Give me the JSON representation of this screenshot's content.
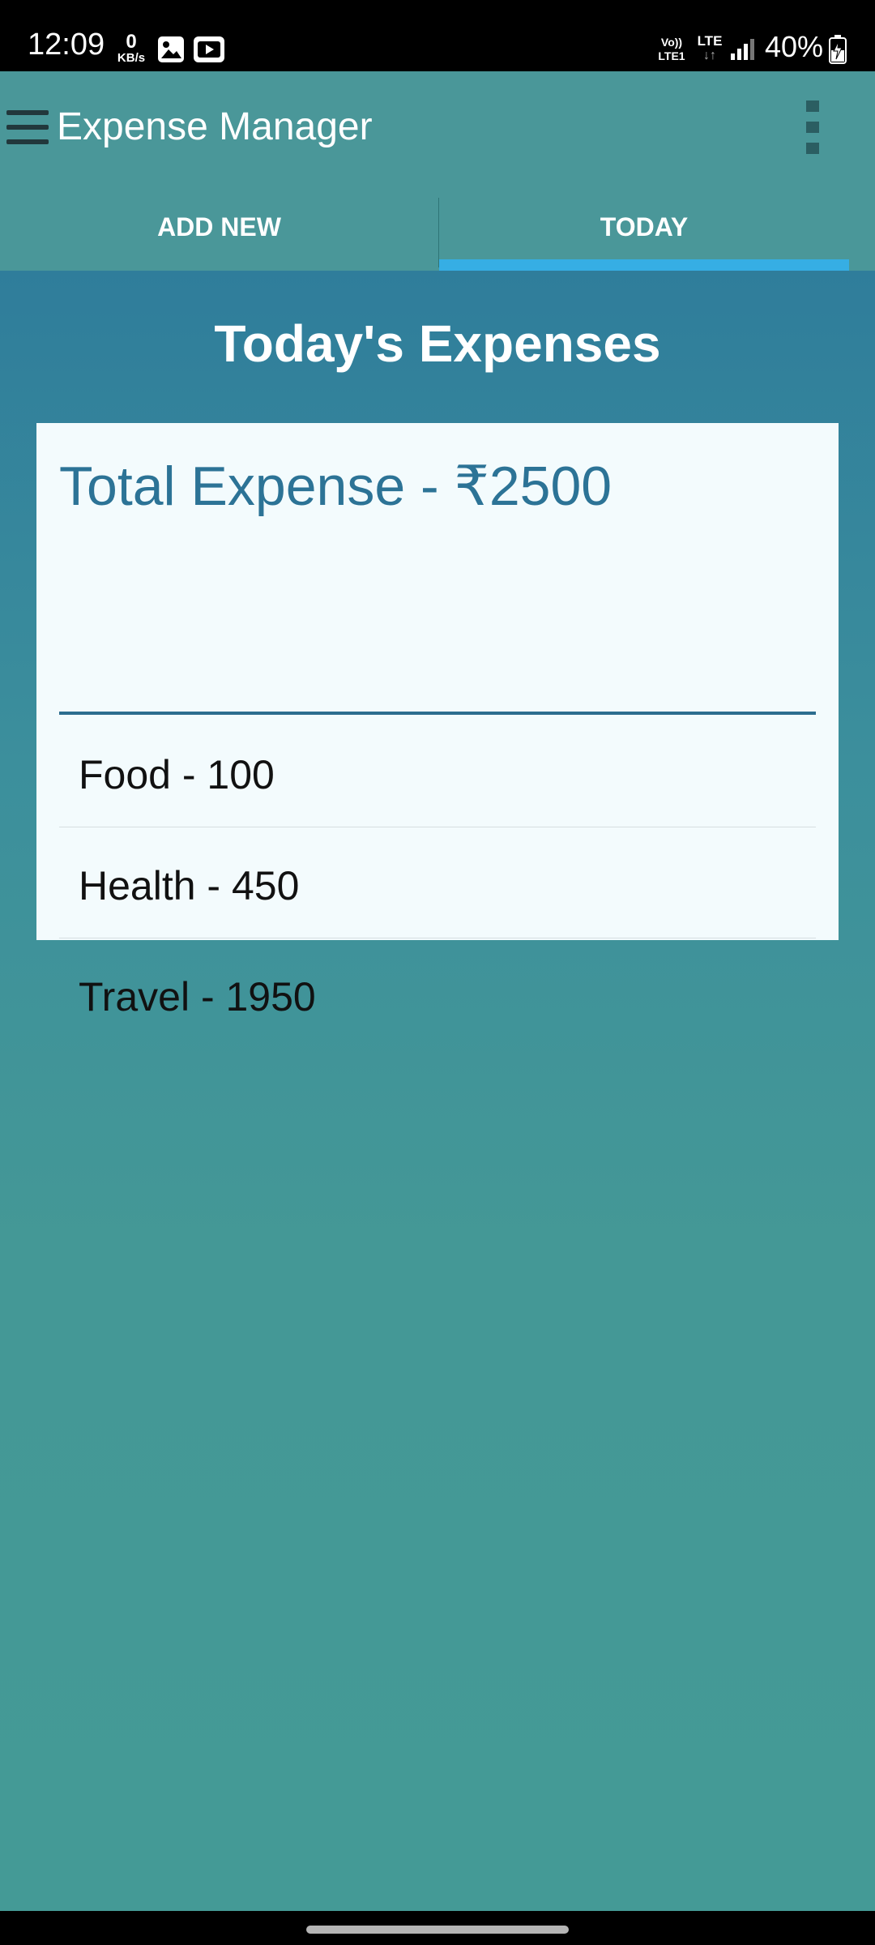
{
  "status_bar": {
    "time": "12:09",
    "net_speed_value": "0",
    "net_speed_unit": "KB/s",
    "notification_icons": [
      "gallery-icon",
      "youtube-icon"
    ],
    "volte_line1": "Vo))",
    "volte_line2": "LTE1",
    "network_type": "LTE",
    "network_arrows": "↓↑",
    "battery_percent": "40%",
    "battery_charging": true
  },
  "app_bar": {
    "title": "Expense Manager",
    "color": "#4a9799",
    "menu_icon": "hamburger-menu-icon",
    "overflow_icon": "more-vert-icon"
  },
  "tabs": [
    {
      "label": "ADD NEW",
      "selected": false
    },
    {
      "label": "TODAY",
      "selected": true
    }
  ],
  "tab_indicator_color": "#36aee4",
  "main": {
    "heading": "Today's Expenses",
    "total_label": "Total Expense - ₹2500",
    "expenses": [
      {
        "label": "Food - 100"
      },
      {
        "label": "Health - 450"
      },
      {
        "label": "Travel - 1950"
      }
    ]
  }
}
